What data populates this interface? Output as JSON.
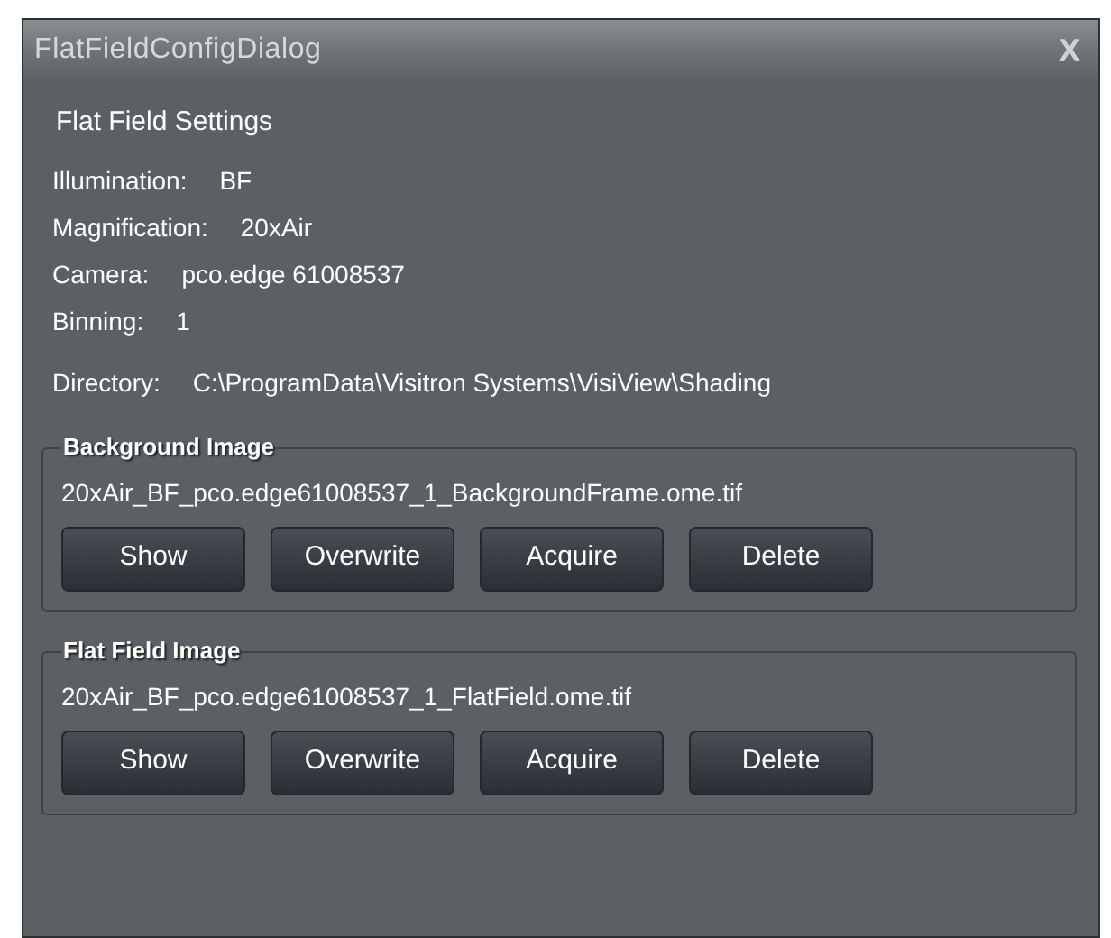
{
  "window": {
    "title": "FlatFieldConfigDialog",
    "close": "X"
  },
  "heading": "Flat Field Settings",
  "info": [
    {
      "label": "Illumination:",
      "value": "BF"
    },
    {
      "label": "Magnification:",
      "value": "20xAir"
    },
    {
      "label": "Camera:",
      "value": "pco.edge 61008537"
    },
    {
      "label": "Binning:",
      "value": "1"
    }
  ],
  "directory": {
    "label": "Directory:",
    "value": "C:\\ProgramData\\Visitron Systems\\VisiView\\Shading"
  },
  "groups": [
    {
      "title": "Background Image",
      "file": "20xAir_BF_pco.edge61008537_1_BackgroundFrame.ome.tif",
      "buttons": [
        "Show",
        "Overwrite",
        "Acquire",
        "Delete"
      ]
    },
    {
      "title": "Flat Field Image",
      "file": "20xAir_BF_pco.edge61008537_1_FlatField.ome.tif",
      "buttons": [
        "Show",
        "Overwrite",
        "Acquire",
        "Delete"
      ]
    }
  ]
}
